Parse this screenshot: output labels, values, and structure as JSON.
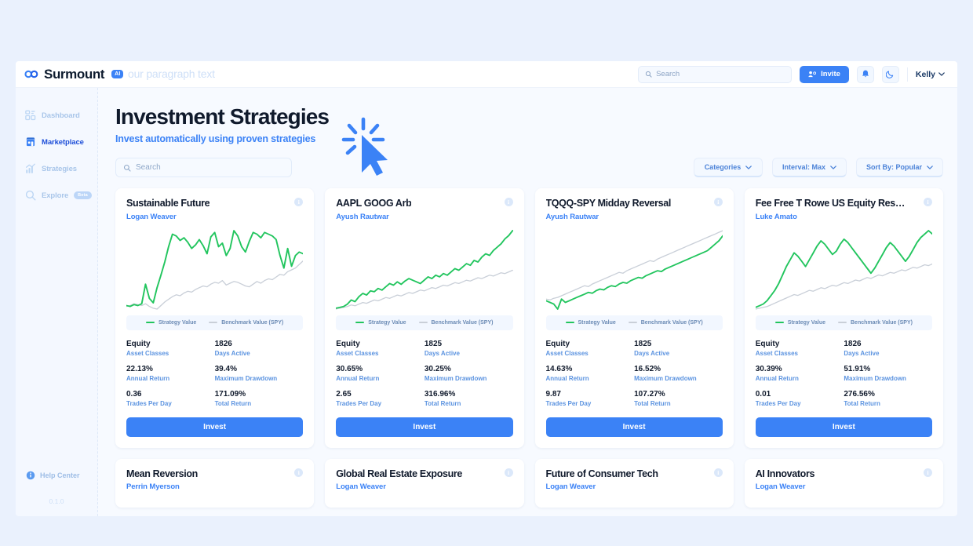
{
  "topbar": {
    "brand_name": "Surmount",
    "brand_chip": "AI",
    "ghost_text": "our paragraph text",
    "search_placeholder": "Search",
    "invite_label": "Invite",
    "notifications_icon": "bell-icon",
    "theme_icon": "moon-icon",
    "user_name": "Kelly"
  },
  "sidebar": {
    "items": [
      {
        "label": "Dashboard",
        "icon": "dashboard-icon",
        "active": false,
        "badge": ""
      },
      {
        "label": "Marketplace",
        "icon": "store-icon",
        "active": true,
        "badge": ""
      },
      {
        "label": "Strategies",
        "icon": "chart-bars-icon",
        "active": false,
        "badge": ""
      },
      {
        "label": "Explore",
        "icon": "search-icon",
        "active": false,
        "badge": "Beta"
      }
    ],
    "help_label": "Help Center",
    "version": "0.1.0"
  },
  "page": {
    "title": "Investment Strategies",
    "subtitle": "Invest automatically using proven strategies",
    "search_placeholder": "Search",
    "filters": [
      {
        "label": "Categories"
      },
      {
        "label": "Interval: Max"
      },
      {
        "label": "Sort By: Popular"
      }
    ]
  },
  "legend": {
    "strategy_label": "Strategy Value",
    "benchmark_label": "Benchmark Value (SPY)",
    "strategy_color": "#22c55e",
    "benchmark_color": "#c9cfd8"
  },
  "stat_labels": {
    "asset_classes": "Asset Classes",
    "days_active": "Days Active",
    "annual_return": "Annual Return",
    "max_drawdown": "Maximum Drawdown",
    "trades_per_day": "Trades Per Day",
    "total_return": "Total Return"
  },
  "invest_label": "Invest",
  "info_glyph": "i",
  "cards": [
    {
      "title": "Sustainable Future",
      "author": "Logan Weaver",
      "asset_classes": "Equity",
      "days_active": "1826",
      "annual_return": "22.13%",
      "max_drawdown": "39.4%",
      "trades_per_day": "0.36",
      "total_return": "171.09%"
    },
    {
      "title": "AAPL GOOG Arb",
      "author": "Ayush Rautwar",
      "asset_classes": "Equity",
      "days_active": "1825",
      "annual_return": "30.65%",
      "max_drawdown": "30.25%",
      "trades_per_day": "2.65",
      "total_return": "316.96%"
    },
    {
      "title": "TQQQ-SPY Midday Reversal",
      "author": "Ayush Rautwar",
      "asset_classes": "Equity",
      "days_active": "1825",
      "annual_return": "14.63%",
      "max_drawdown": "16.52%",
      "trades_per_day": "9.87",
      "total_return": "107.27%"
    },
    {
      "title": "Fee Free T Rowe US Equity Resea…",
      "author": "Luke Amato",
      "asset_classes": "Equity",
      "days_active": "1826",
      "annual_return": "30.39%",
      "max_drawdown": "51.91%",
      "trades_per_day": "0.01",
      "total_return": "276.56%"
    }
  ],
  "cards_row2": [
    {
      "title": "Mean Reversion",
      "author": "Perrin Myerson"
    },
    {
      "title": "Global Real Estate Exposure",
      "author": "Logan Weaver"
    },
    {
      "title": "Future of Consumer Tech",
      "author": "Logan Weaver"
    },
    {
      "title": "AI Innovators",
      "author": "Logan Weaver"
    }
  ],
  "chart_data": {
    "type": "line",
    "title": "Strategy vs Benchmark performance (4 cards)",
    "xlabel": "",
    "ylabel": "",
    "grid": false,
    "legend_position": "bottom",
    "series_colors": {
      "strategy": "#22c55e",
      "benchmark": "#c9cfd8"
    },
    "charts": [
      {
        "card": "Sustainable Future",
        "series": [
          {
            "name": "Strategy Value",
            "values": [
              6,
              5,
              7,
              6,
              8,
              30,
              14,
              9,
              26,
              40,
              55,
              72,
              86,
              84,
              79,
              82,
              77,
              70,
              74,
              80,
              73,
              64,
              83,
              88,
              72,
              76,
              62,
              70,
              90,
              84,
              72,
              66,
              78,
              88,
              86,
              82,
              88,
              86,
              84,
              80,
              62,
              48,
              70,
              50,
              62,
              66,
              64
            ]
          },
          {
            "name": "Benchmark Value (SPY)",
            "values": [
              5,
              6,
              8,
              7,
              6,
              8,
              5,
              3,
              2,
              6,
              10,
              13,
              16,
              18,
              17,
              20,
              22,
              21,
              24,
              26,
              28,
              27,
              30,
              32,
              31,
              34,
              29,
              31,
              33,
              32,
              30,
              28,
              27,
              30,
              33,
              31,
              34,
              36,
              35,
              38,
              41,
              40,
              44,
              46,
              48,
              52,
              56
            ]
          }
        ]
      },
      {
        "card": "AAPL GOOG Arb",
        "series": [
          {
            "name": "Strategy Value",
            "values": [
              4,
              5,
              6,
              9,
              14,
              12,
              18,
              22,
              20,
              25,
              24,
              28,
              26,
              30,
              34,
              32,
              36,
              33,
              37,
              40,
              38,
              36,
              34,
              38,
              42,
              40,
              44,
              42,
              46,
              44,
              48,
              52,
              50,
              54,
              58,
              56,
              62,
              60,
              66,
              70,
              68,
              74,
              78,
              82,
              88,
              92,
              98
            ]
          },
          {
            "name": "Benchmark Value (SPY)",
            "values": [
              3,
              4,
              5,
              6,
              8,
              7,
              9,
              11,
              10,
              12,
              14,
              13,
              15,
              17,
              16,
              18,
              20,
              19,
              21,
              23,
              22,
              24,
              26,
              25,
              27,
              29,
              28,
              30,
              32,
              31,
              33,
              35,
              34,
              36,
              38,
              37,
              39,
              41,
              40,
              42,
              44,
              43,
              45,
              47,
              46,
              48,
              50
            ]
          }
        ]
      },
      {
        "card": "TQQQ-SPY Midday Reversal",
        "series": [
          {
            "name": "Strategy Value",
            "values": [
              12,
              10,
              8,
              2,
              14,
              10,
              12,
              14,
              16,
              18,
              20,
              22,
              21,
              24,
              26,
              25,
              28,
              30,
              29,
              32,
              34,
              33,
              36,
              38,
              40,
              39,
              42,
              44,
              46,
              48,
              47,
              50,
              52,
              54,
              56,
              58,
              60,
              62,
              64,
              66,
              68,
              70,
              72,
              76,
              80,
              84,
              90
            ]
          },
          {
            "name": "Benchmark Value (SPY)",
            "values": [
              14,
              13,
              15,
              16,
              18,
              20,
              22,
              24,
              26,
              28,
              30,
              29,
              32,
              34,
              36,
              38,
              40,
              42,
              44,
              46,
              45,
              48,
              50,
              52,
              54,
              56,
              58,
              60,
              59,
              62,
              64,
              66,
              68,
              70,
              72,
              74,
              76,
              78,
              80,
              82,
              84,
              86,
              88,
              90,
              92,
              94,
              96
            ]
          }
        ]
      },
      {
        "card": "Fee Free T Rowe US Equity Resea…",
        "series": [
          {
            "name": "Strategy Value",
            "values": [
              6,
              8,
              10,
              14,
              20,
              26,
              34,
              44,
              54,
              62,
              70,
              66,
              60,
              54,
              62,
              70,
              78,
              84,
              80,
              74,
              68,
              72,
              80,
              86,
              82,
              76,
              70,
              64,
              58,
              52,
              46,
              52,
              60,
              68,
              76,
              82,
              78,
              72,
              66,
              60,
              66,
              74,
              82,
              88,
              92,
              96,
              92
            ]
          },
          {
            "name": "Benchmark Value (SPY)",
            "values": [
              4,
              5,
              6,
              7,
              9,
              11,
              13,
              15,
              17,
              19,
              21,
              20,
              22,
              24,
              26,
              25,
              27,
              29,
              28,
              30,
              32,
              31,
              33,
              35,
              34,
              36,
              38,
              37,
              39,
              41,
              40,
              42,
              44,
              43,
              45,
              47,
              46,
              48,
              50,
              49,
              51,
              53,
              52,
              54,
              56,
              55,
              57
            ]
          }
        ]
      }
    ]
  }
}
